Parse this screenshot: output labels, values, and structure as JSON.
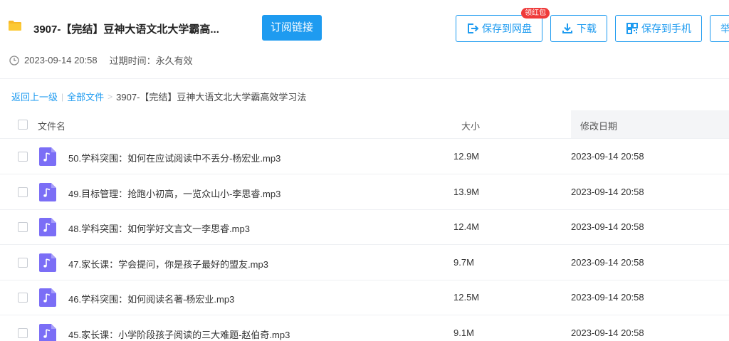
{
  "header": {
    "share_title": "3907-【完结】豆神大语文北大学霸高...",
    "subscribe_label": "订阅链接",
    "save_disk_label": "保存到网盘",
    "save_disk_badge": "领红包",
    "download_label": "下载",
    "save_phone_label": "保存到手机",
    "report_label": "举",
    "accent_color": "#1e9bf0",
    "badge_color": "#ef3a3a"
  },
  "meta": {
    "share_time": "2023-09-14 20:58",
    "expire_label": "过期时间：永久有效"
  },
  "breadcrumb": {
    "back_label": "返回上一级",
    "sep1": "|",
    "all_files_label": "全部文件",
    "sep2": ">",
    "current": "3907-【完结】豆神大语文北大学霸高效学习法"
  },
  "table": {
    "columns": {
      "name": "文件名",
      "size": "大小",
      "date": "修改日期"
    },
    "rows": [
      {
        "name": "50.学科突围：如何在应试阅读中不丢分-杨宏业.mp3",
        "size": "12.9M",
        "date": "2023-09-14 20:58",
        "icon": "music-file-icon"
      },
      {
        "name": "49.目标管理：抢跑小初高，一览众山小-李思睿.mp3",
        "size": "13.9M",
        "date": "2023-09-14 20:58",
        "icon": "music-file-icon"
      },
      {
        "name": "48.学科突围：如何学好文言文一李思睿.mp3",
        "size": "12.4M",
        "date": "2023-09-14 20:58",
        "icon": "music-file-icon"
      },
      {
        "name": "47.家长课：学会提问，你是孩子最好的盟友.mp3",
        "size": "9.7M",
        "date": "2023-09-14 20:58",
        "icon": "music-file-icon"
      },
      {
        "name": "46.学科突围：如何阅读名著-杨宏业.mp3",
        "size": "12.5M",
        "date": "2023-09-14 20:58",
        "icon": "music-file-icon"
      },
      {
        "name": "45.家长课：小学阶段孩子阅读的三大难题-赵伯奇.mp3",
        "size": "9.1M",
        "date": "2023-09-14 20:58",
        "icon": "music-file-icon"
      }
    ]
  }
}
